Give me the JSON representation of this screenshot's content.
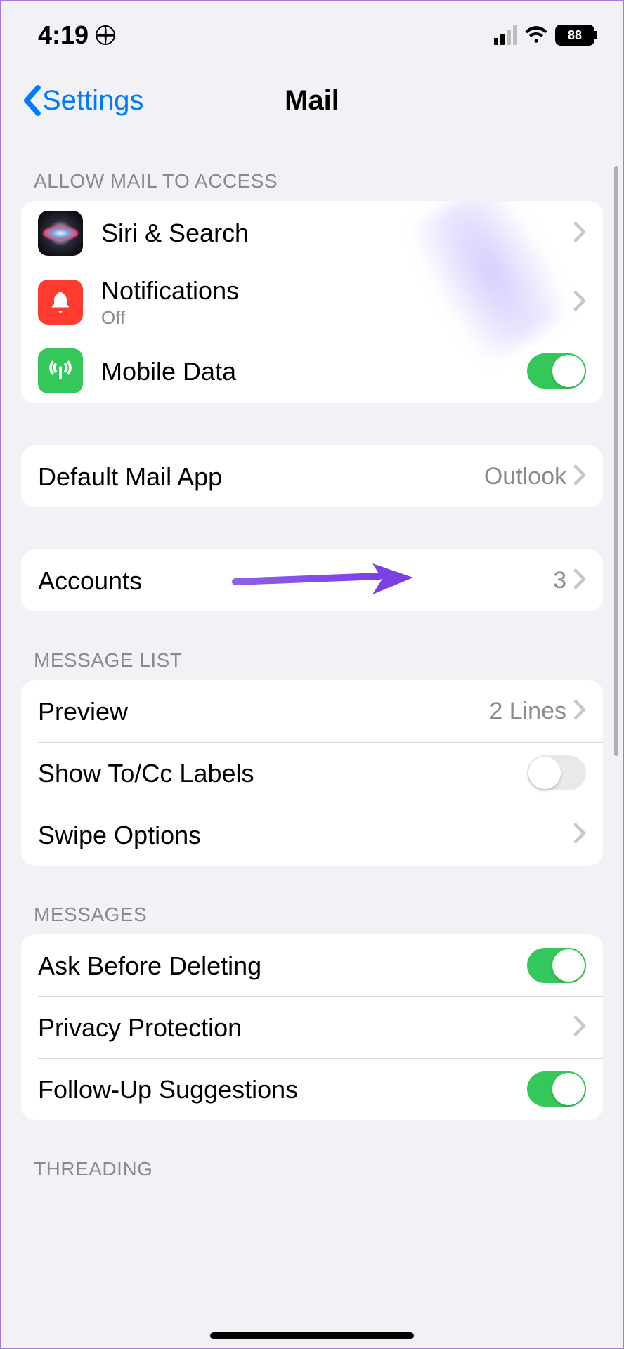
{
  "status": {
    "time": "4:19",
    "battery": "88"
  },
  "nav": {
    "back": "Settings",
    "title": "Mail"
  },
  "sections": {
    "access": {
      "header": "Allow Mail to Access",
      "siri": "Siri & Search",
      "notifications": {
        "label": "Notifications",
        "sub": "Off"
      },
      "mobile_data": {
        "label": "Mobile Data",
        "on": true
      }
    },
    "default_app": {
      "label": "Default Mail App",
      "value": "Outlook"
    },
    "accounts": {
      "label": "Accounts",
      "value": "3"
    },
    "message_list": {
      "header": "Message List",
      "preview": {
        "label": "Preview",
        "value": "2 Lines"
      },
      "show_tocc": {
        "label": "Show To/Cc Labels",
        "on": false
      },
      "swipe": {
        "label": "Swipe Options"
      }
    },
    "messages": {
      "header": "Messages",
      "ask_delete": {
        "label": "Ask Before Deleting",
        "on": true
      },
      "privacy": {
        "label": "Privacy Protection"
      },
      "followup": {
        "label": "Follow-Up Suggestions",
        "on": true
      }
    },
    "threading": {
      "header": "Threading"
    }
  }
}
